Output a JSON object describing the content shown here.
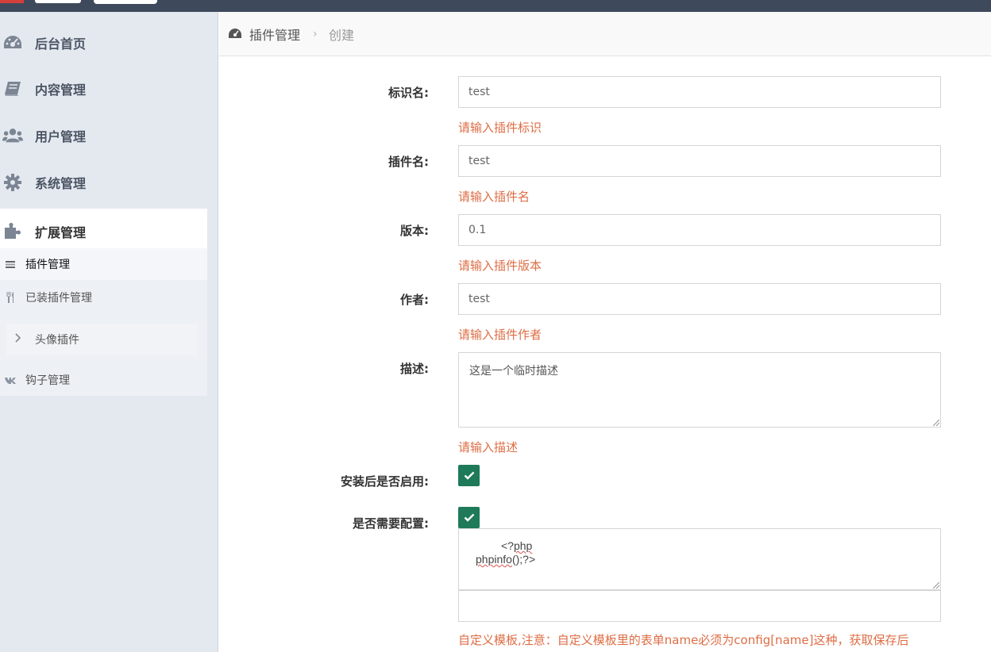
{
  "sidebar": {
    "items": [
      {
        "label": "后台首页",
        "icon": "dashboard-icon"
      },
      {
        "label": "内容管理",
        "icon": "book-icon"
      },
      {
        "label": "用户管理",
        "icon": "users-icon"
      },
      {
        "label": "系统管理",
        "icon": "gear-icon"
      },
      {
        "label": "扩展管理",
        "icon": "puzzle-icon"
      }
    ],
    "sub_items": [
      {
        "label": "插件管理",
        "icon": "list-icon"
      },
      {
        "label": "已装插件管理",
        "icon": "cutlery-icon"
      },
      {
        "label": "头像插件",
        "icon": "chevron-right-icon"
      },
      {
        "label": "钩子管理",
        "icon": "vk-icon"
      }
    ]
  },
  "breadcrumb": {
    "items": [
      "插件管理",
      "创建"
    ],
    "separator": "›"
  },
  "form": {
    "fields": [
      {
        "label": "标识名:",
        "value": "test",
        "hint": "请输入插件标识"
      },
      {
        "label": "插件名:",
        "value": "test",
        "hint": "请输入插件名"
      },
      {
        "label": "版本:",
        "value": "0.1",
        "hint": "请输入插件版本"
      },
      {
        "label": "作者:",
        "value": "test",
        "hint": "请输入插件作者"
      },
      {
        "label": "描述:",
        "value": "这是一个临时描述",
        "hint": "请输入描述"
      }
    ],
    "enable_after_install": {
      "label": "安装后是否启用:",
      "checked": true
    },
    "need_config": {
      "label": "是否需要配置:",
      "checked": true
    },
    "config_code": {
      "line1_prefix": "<?",
      "line1_word": "php",
      "line2_word": "phpinfo",
      "line2_suffix": "();?>"
    },
    "template_note": "自定义模板,注意：自定义模板里的表单name必须为config[name]这种，获取保存后"
  },
  "colors": {
    "topbar": "#3e4a5c",
    "sidebar": "#e4e9f0",
    "hint": "#dd6d45",
    "checkbox": "#1e7a59"
  }
}
